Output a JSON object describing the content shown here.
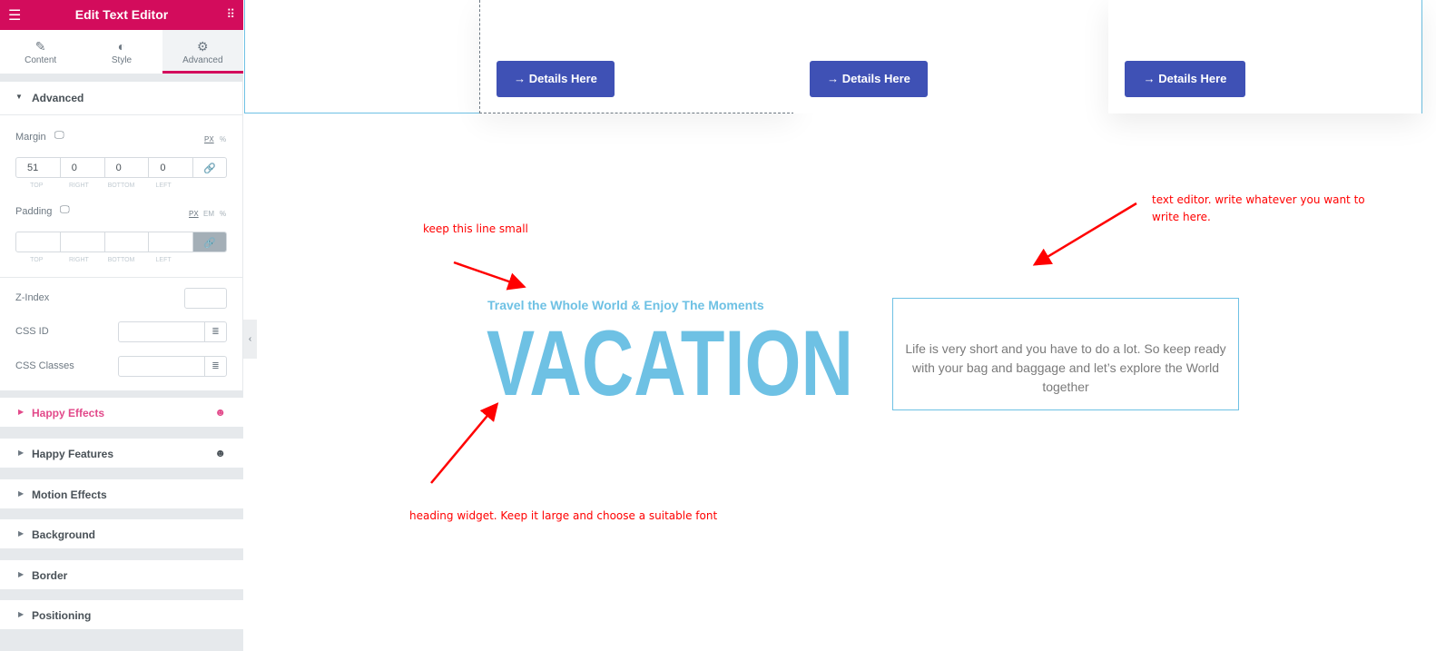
{
  "panel": {
    "title": "Edit Text Editor",
    "menu_icon": "hamburger-icon",
    "grid_icon": "grid-icon",
    "tabs": [
      {
        "label": "Content",
        "icon": "pencil-icon"
      },
      {
        "label": "Style",
        "icon": "half-circle-icon"
      },
      {
        "label": "Advanced",
        "icon": "gear-icon",
        "active": true
      }
    ],
    "advanced": {
      "title": "Advanced",
      "margin": {
        "label": "Margin",
        "units": [
          "PX",
          "%"
        ],
        "values": [
          "51",
          "0",
          "0",
          "0"
        ],
        "sides": [
          "TOP",
          "RIGHT",
          "BOTTOM",
          "LEFT"
        ]
      },
      "padding": {
        "label": "Padding",
        "units": [
          "PX",
          "EM",
          "%"
        ],
        "values": [
          "",
          "",
          "",
          ""
        ],
        "sides": [
          "TOP",
          "RIGHT",
          "BOTTOM",
          "LEFT"
        ]
      },
      "z_index": {
        "label": "Z-Index",
        "value": ""
      },
      "css_id": {
        "label": "CSS ID",
        "value": ""
      },
      "css_classes": {
        "label": "CSS Classes",
        "value": ""
      }
    },
    "sections": [
      "Happy Effects",
      "Happy Features",
      "Motion Effects",
      "Background",
      "Border",
      "Positioning"
    ],
    "accent": "#d30c5c"
  },
  "canvas": {
    "cards": [
      {
        "button": "Details Here"
      },
      {
        "button": "Details Here"
      },
      {
        "button": "Details Here"
      }
    ],
    "button_color": "#3f51b5",
    "subtitle": "Travel the Whole World & Enjoy The Moments",
    "heading": "VACATION",
    "heading_color": "#6ec1e4",
    "text_editor": "Life is very short and you have to do a lot. So keep ready with your bag and baggage and let’s explore the World together",
    "notes": {
      "small": "keep this line small",
      "editor": "text editor. write whatever you want to write here.",
      "heading": "heading widget. Keep it large and choose a suitable font"
    }
  }
}
